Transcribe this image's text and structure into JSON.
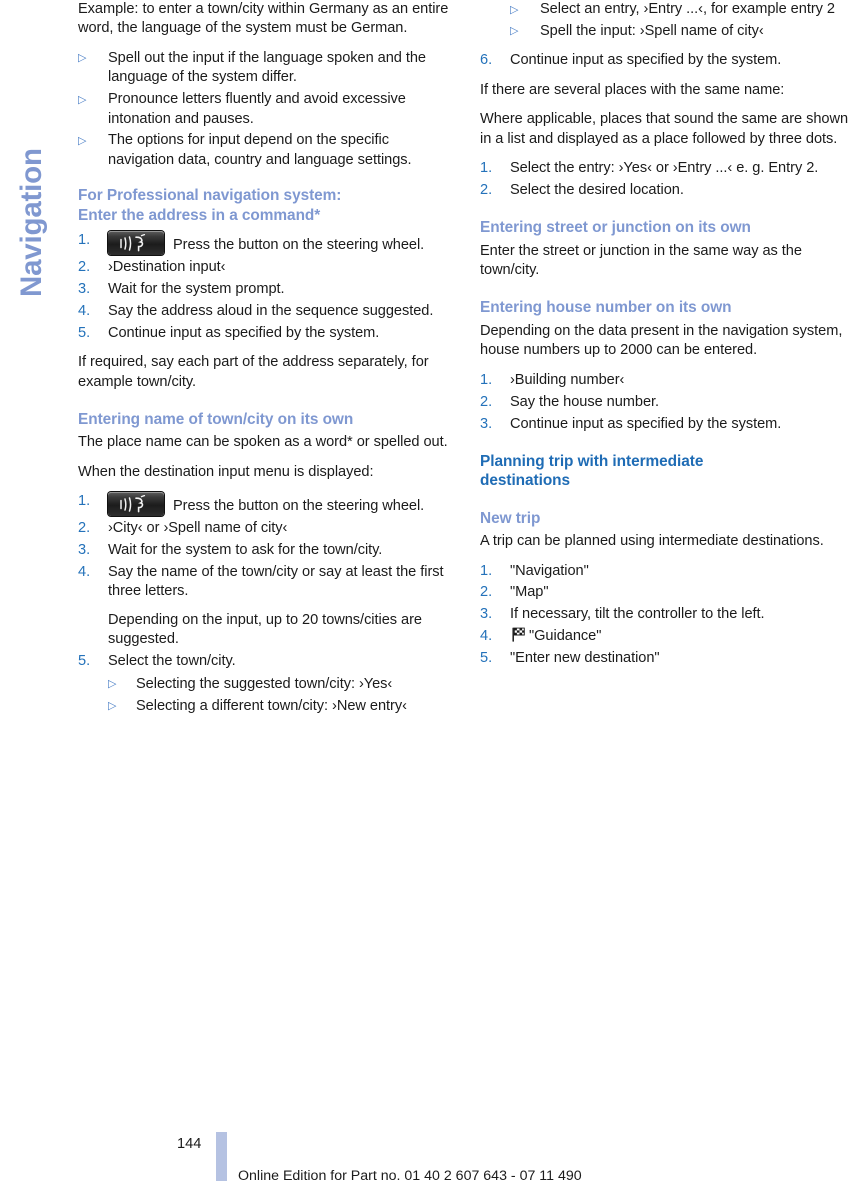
{
  "chapter": {
    "label": "Navigation"
  },
  "colors": {
    "heading_primary": "#1f6cb5",
    "heading_secondary": "#7f98d1",
    "list_marker": "#2472ba",
    "bullet_marker": "#4b7fc6",
    "tab_text": "#8098d0",
    "footer_bar": "#b5c2e2",
    "body_text": "#1b1b1b"
  },
  "icons": {
    "voice_button": "voice-control-button-icon",
    "guidance_flag": "checkered-flag-icon",
    "bullet_triangle": "triangle-right-bullet-icon"
  },
  "left_column": {
    "intro_note": "Example: to enter a town/city within Germany as an entire word, the language of the system must be German.",
    "intro_bullets": [
      "Spell out the input if the language spoken and the language of the system differ.",
      "Pronounce letters fluently and avoid excessive intonation and pauses.",
      "The options for input depend on the specific navigation data, country and language settings."
    ],
    "section_command": {
      "heading_line1": "For Professional navigation system:",
      "heading_line2": "Enter the address in a command*",
      "steps": [
        "Press the button on the steering wheel.",
        "›Destination input‹",
        "Wait for the system prompt.",
        "Say the address aloud in the sequence suggested.",
        "Continue input as specified by the system."
      ],
      "after_note": "If required, say each part of the address separately, for example town/city."
    },
    "section_town": {
      "heading": "Entering name of town/city on its own",
      "para1": "The place name can be spoken as a word* or spelled out.",
      "para2": "When the destination input menu is displayed:",
      "steps": [
        "Press the button on the steering wheel.",
        "›City‹ or ›Spell name of city‹",
        "Wait for the system to ask for the town/city.",
        "Say the name of the town/city or say at least the first three letters.",
        "Select the town/city."
      ],
      "step4_note": "Depending on the input, up to 20 towns/cities are suggested.",
      "step5_bullets": [
        "Selecting the suggested town/city: ›Yes‹",
        "Selecting a different town/city: ›New entry‹"
      ]
    }
  },
  "right_column": {
    "continued_bullets": [
      "Select an entry, ›Entry ...‹, for example entry 2",
      "Spell the input: ›Spell name of city‹"
    ],
    "step6": "Continue input as specified by the system.",
    "same_name": {
      "lead": "If there are several places with the same name:",
      "para": "Where applicable, places that sound the same are shown in a list and displayed as a place followed by three dots.",
      "steps": [
        "Select the entry: ›Yes‹ or ›Entry ...‹ e. g. Entry 2.",
        "Select the desired location."
      ]
    },
    "section_street": {
      "heading": "Entering street or junction on its own",
      "para": "Enter the street or junction in the same way as the town/city."
    },
    "section_house": {
      "heading": "Entering house number on its own",
      "para": "Depending on the data present in the navigation system, house numbers up to 2000 can be entered.",
      "steps": [
        "›Building number‹",
        "Say the house number.",
        "Continue input as specified by the system."
      ]
    },
    "section_trip": {
      "heading_line1": "Planning trip with intermediate",
      "heading_line2": "destinations",
      "subheading": "New trip",
      "para": "A trip can be planned using intermediate destinations.",
      "steps": [
        "\"Navigation\"",
        "\"Map\"",
        "If necessary, tilt the controller to the left.",
        "\"Guidance\"",
        "\"Enter new destination\""
      ]
    }
  },
  "footer": {
    "page_number": "144",
    "imprint": "Online Edition for Part no. 01 40 2 607 643 - 07 11 490"
  }
}
